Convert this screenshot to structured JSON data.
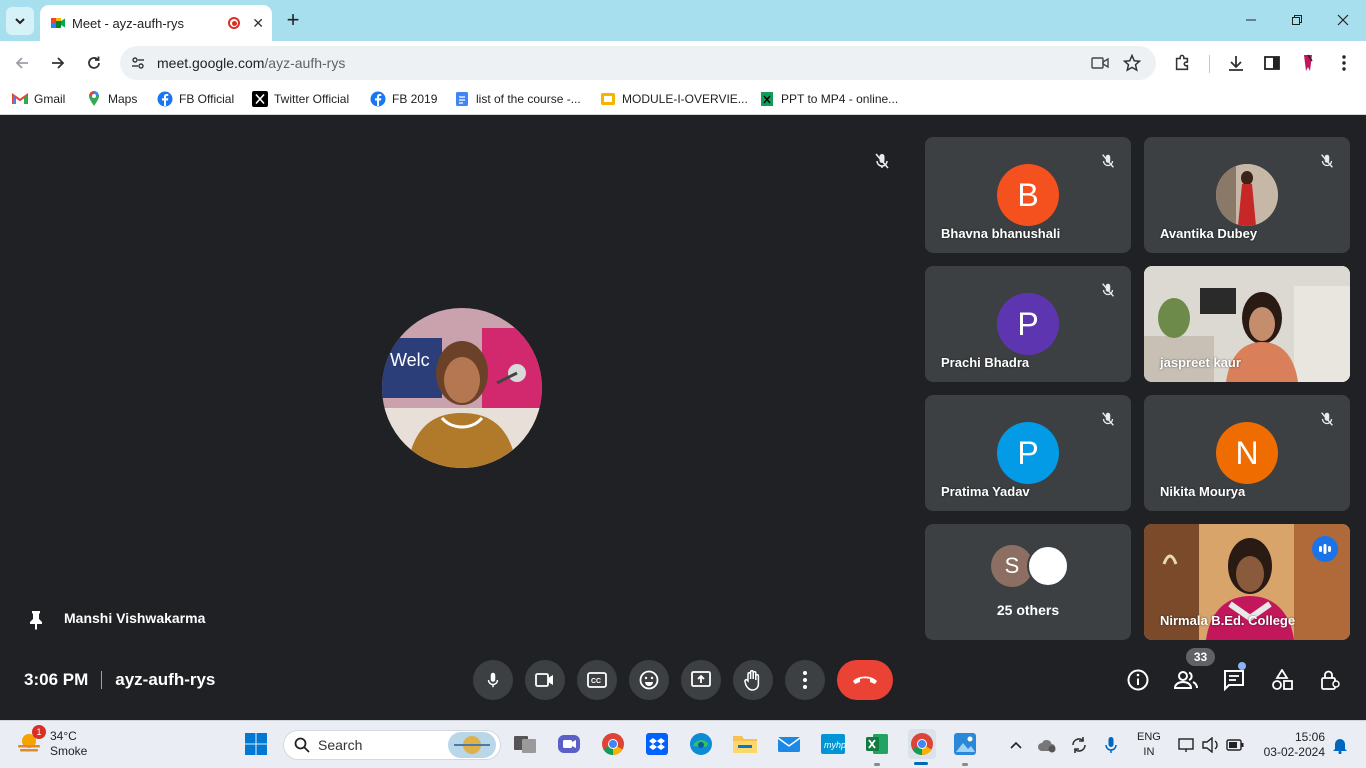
{
  "browser": {
    "tab_title": "Meet - ayz-aufh-rys",
    "url_domain": "meet.google.com",
    "url_path": "/ayz-aufh-rys",
    "bookmarks": [
      {
        "label": "Gmail",
        "icon": "gmail-icon"
      },
      {
        "label": "Maps",
        "icon": "maps-icon"
      },
      {
        "label": "FB Official",
        "icon": "facebook-icon"
      },
      {
        "label": "Twitter Official",
        "icon": "x-icon"
      },
      {
        "label": "FB 2019",
        "icon": "facebook-icon"
      },
      {
        "label": "list of the course -...",
        "icon": "docs-icon"
      },
      {
        "label": "MODULE-I-OVERVIE...",
        "icon": "slides-icon"
      },
      {
        "label": "PPT to MP4 - online...",
        "icon": "sheet-icon"
      }
    ]
  },
  "meet": {
    "main_speaker": "Manshi Vishwakarma",
    "time": "3:06 PM",
    "meeting_code": "ayz-aufh-rys",
    "participant_count": "33",
    "tiles": [
      {
        "name": "Bhavna bhanushali",
        "initial": "B",
        "color": "#f4511e",
        "muted": true
      },
      {
        "name": "Avantika Dubey",
        "initial": "",
        "muted": true
      },
      {
        "name": "Prachi Bhadra",
        "initial": "P",
        "color": "#5e35b1",
        "muted": true
      },
      {
        "name": "jaspreet kaur",
        "initial": "",
        "muted": false
      },
      {
        "name": "Pratima Yadav",
        "initial": "P",
        "color": "#039be5",
        "muted": true
      },
      {
        "name": "Nikita Mourya",
        "initial": "N",
        "color": "#ef6c00",
        "muted": true
      },
      {
        "name": "Nirmala B.Ed. College",
        "initial": "",
        "muted": false,
        "speaking": true
      }
    ],
    "others": {
      "initial": "S",
      "label": "25 others"
    }
  },
  "taskbar": {
    "weather_temp": "34°C",
    "weather_desc": "Smoke",
    "weather_badge": "1",
    "search_label": "Search",
    "lang_line1": "ENG",
    "lang_line2": "IN",
    "time": "15:06",
    "date": "03-02-2024"
  }
}
